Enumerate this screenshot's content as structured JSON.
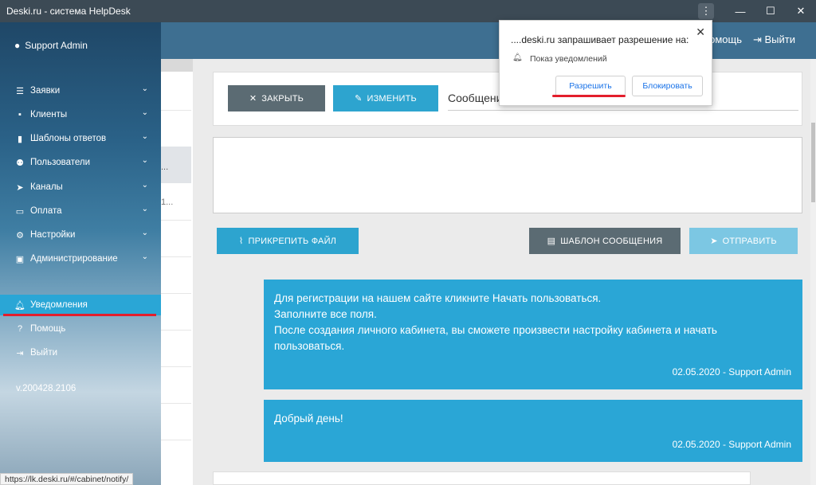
{
  "window": {
    "title": "Deski.ru - система HelpDesk",
    "menu_icon": "⋮",
    "minimize": "—",
    "maximize": "☐",
    "close": "✕"
  },
  "header": {
    "help_label": "омощь",
    "logout_label": "Выйти"
  },
  "sidebar": {
    "user_name": "Support Admin",
    "items": [
      {
        "label": "Заявки",
        "icon": "list-icon"
      },
      {
        "label": "Клиенты",
        "icon": "contact-icon"
      },
      {
        "label": "Шаблоны ответов",
        "icon": "book-icon"
      },
      {
        "label": "Пользователи",
        "icon": "users-icon"
      },
      {
        "label": "Каналы",
        "icon": "send-icon"
      },
      {
        "label": "Оплата",
        "icon": "card-icon"
      },
      {
        "label": "Настройки",
        "icon": "gear-icon"
      },
      {
        "label": "Администрирование",
        "icon": "lock-icon"
      }
    ],
    "bottom_items": [
      {
        "label": "Уведомления",
        "icon": "bell-icon"
      },
      {
        "label": "Помощь",
        "icon": "question-icon"
      },
      {
        "label": "Выйти",
        "icon": "logout-icon"
      }
    ],
    "version": "v.200428.2106"
  },
  "list": {
    "truncated": "...",
    "number_fragment": "1..."
  },
  "toolbar": {
    "close_label": "ЗАКРЫТЬ",
    "edit_label": "ИЗМЕНИТЬ",
    "message_label": "Сообщени"
  },
  "compose": {
    "attach_label": "ПРИКРЕПИТЬ ФАЙЛ",
    "template_label": "ШАБЛОН СООБЩЕНИЯ",
    "send_label": "ОТПРАВИТЬ"
  },
  "messages": [
    {
      "lines": [
        "Для регистрации на нашем сайте кликните Начать пользоваться.",
        "Заполните все поля.",
        "После создания личного кабинета, вы сможете произвести настройку кабинета и начать",
        "пользоваться."
      ],
      "meta": "02.05.2020 - Support Admin"
    },
    {
      "lines": [
        "Добрый день!"
      ],
      "meta": "02.05.2020 - Support Admin"
    }
  ],
  "permission_popup": {
    "title": "....deski.ru запрашивает разрешение на:",
    "description": "Показ уведомлений",
    "allow_label": "Разрешить",
    "block_label": "Блокировать",
    "close": "✕"
  },
  "status_url": "https://lk.deski.ru/#/cabinet/notify/",
  "colors": {
    "accent": "#2aa6d6",
    "dark_button": "#5b6b73",
    "highlight_red": "#e31e2c",
    "header": "#3e6f91"
  }
}
